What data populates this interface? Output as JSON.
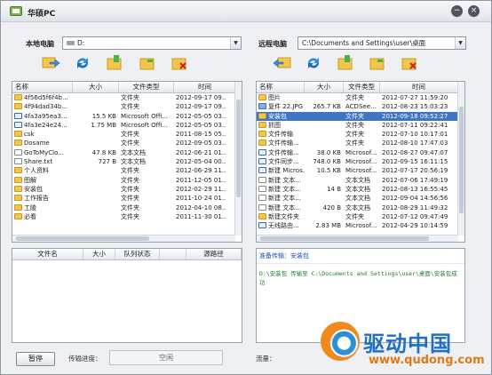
{
  "window": {
    "title": "华硕PC"
  },
  "local": {
    "label": "本地电脑",
    "path": "D:",
    "columns": [
      "名称",
      "大小",
      "文件类型",
      "时间"
    ],
    "files": [
      {
        "name": "4f56d5f6f4b...",
        "size": "",
        "type": "文件夹",
        "time": "2012-09-17 09..",
        "icon": "folder"
      },
      {
        "name": "4f94dad34b...",
        "size": "",
        "type": "文件夹",
        "time": "2012-09-17 09..",
        "icon": "folder"
      },
      {
        "name": "4fa3a95ea3...",
        "size": "15.5 KB",
        "type": "Microsoft Offi...",
        "time": "2012-05-05 03..",
        "icon": "doc"
      },
      {
        "name": "4fa3e24e24...",
        "size": "1.75 MB",
        "type": "Microsoft Offi...",
        "time": "2012-05-05 03..",
        "icon": "doc"
      },
      {
        "name": "csk",
        "size": "",
        "type": "文件夹",
        "time": "2011-08-15 05..",
        "icon": "folder"
      },
      {
        "name": "Dosame",
        "size": "",
        "type": "文件夹",
        "time": "2012-09-05 03..",
        "icon": "folder"
      },
      {
        "name": "GoToMyClo...",
        "size": "47.8 KB",
        "type": "文本文档",
        "time": "2012-06-21 01..",
        "icon": "txt"
      },
      {
        "name": "Share.txt",
        "size": "727 B",
        "type": "文本文档",
        "time": "2012-05-04 00..",
        "icon": "txt"
      },
      {
        "name": "个人资料",
        "size": "",
        "type": "文件夹",
        "time": "2012-06-29 11..",
        "icon": "folder"
      },
      {
        "name": "图解",
        "size": "",
        "type": "文件夹",
        "time": "2011-12-05 01..",
        "icon": "folder"
      },
      {
        "name": "安装包",
        "size": "",
        "type": "文件夹",
        "time": "2012-02-29 11..",
        "icon": "folder"
      },
      {
        "name": "工作报告",
        "size": "",
        "type": "文件夹",
        "time": "2011-10-24 01..",
        "icon": "folder"
      },
      {
        "name": "工陵",
        "size": "",
        "type": "文件夹",
        "time": "2012-04-10 08..",
        "icon": "folder"
      },
      {
        "name": "必看",
        "size": "",
        "type": "文件夹",
        "time": "2011-11-30 01..",
        "icon": "folder"
      }
    ]
  },
  "remote": {
    "label": "远程电脑",
    "path": "C:\\Documents and Settings\\user\\桌面",
    "columns": [
      "名称",
      "大小",
      "文件类型",
      "时间"
    ],
    "selected_index": 2,
    "files": [
      {
        "name": "图片",
        "size": "",
        "type": "文件夹",
        "time": "2012-07-27 11:59:20",
        "icon": "folder"
      },
      {
        "name": "复件 22.JPG",
        "size": "265.7 KB",
        "type": "ACDSee...",
        "time": "2012-08-23 15:03:23",
        "icon": "img"
      },
      {
        "name": "安装包",
        "size": "",
        "type": "文件夹",
        "time": "2012-09-18 09:52:27",
        "icon": "folder"
      },
      {
        "name": "抓图",
        "size": "",
        "type": "文件夹",
        "time": "2012-07-11 09:22:41",
        "icon": "folder"
      },
      {
        "name": "文件传输",
        "size": "",
        "type": "文件夹",
        "time": "2012-07-10 10:17:01",
        "icon": "folder"
      },
      {
        "name": "文件传输...",
        "size": "",
        "type": "文件夹",
        "time": "2012-08-10 17:47:03",
        "icon": "folder"
      },
      {
        "name": "文件传输...",
        "size": "38.0 KB",
        "type": "Microsof...",
        "time": "2012-08-27 09:47:07",
        "icon": "doc"
      },
      {
        "name": "文件同步...",
        "size": "748.0 KB",
        "type": "Microsof...",
        "time": "2012-09-15 16:11:15",
        "icon": "doc"
      },
      {
        "name": "新建 Micros...",
        "size": "10.5 KB",
        "type": "Microsof...",
        "time": "2012-07-17 20:56:19",
        "icon": "doc"
      },
      {
        "name": "新建 文本...",
        "size": "",
        "type": "文本文档",
        "time": "2012-07-06 17:49:19",
        "icon": "txt"
      },
      {
        "name": "新建 文本...",
        "size": "14 B",
        "type": "文本文档",
        "time": "2012-08-13 16:55:45",
        "icon": "txt"
      },
      {
        "name": "新建 文本...",
        "size": "",
        "type": "文本文档",
        "time": "2012-09-04 14:56:56",
        "icon": "txt"
      },
      {
        "name": "新建 文本...",
        "size": "420 B",
        "type": "文本文档",
        "time": "2012-08-29 11:49:32",
        "icon": "txt"
      },
      {
        "name": "新建文件夹",
        "size": "",
        "type": "文件夹",
        "time": "2012-07-12 09:47:49",
        "icon": "folder"
      },
      {
        "name": "无线路由...",
        "size": "2.83 MB",
        "type": "Microsof...",
        "time": "2012-04-29 10:14:59",
        "icon": "doc"
      }
    ]
  },
  "queue": {
    "columns": [
      "文件名",
      "大小",
      "队列状态",
      "",
      "源路径"
    ]
  },
  "log": {
    "line1": "准备传输：安装包",
    "line2": "D:\\安装包 传输至 C:\\Documents and Settings\\user\\桌面\\安装包成功"
  },
  "footer": {
    "pause_label": "暂停",
    "progress_label": "传输进度：",
    "progress_text": "空闲",
    "flow_label": "流量："
  },
  "watermark": {
    "cn": "驱动中国",
    "url": "www.qudong.com"
  },
  "icons": {
    "local_tools": [
      "upload-arrow-icon",
      "refresh-icon",
      "new-folder-icon",
      "rename-folder-icon",
      "delete-icon"
    ],
    "remote_tools": [
      "download-arrow-icon",
      "refresh-icon",
      "new-folder-icon",
      "rename-folder-icon",
      "delete-icon"
    ]
  },
  "colors": {
    "selection": "#3f75c5",
    "log_info": "#1d4fb3",
    "log_success": "#1e7f2e",
    "watermark_blue": "#1f6fc8",
    "watermark_orange": "#e07a16"
  }
}
